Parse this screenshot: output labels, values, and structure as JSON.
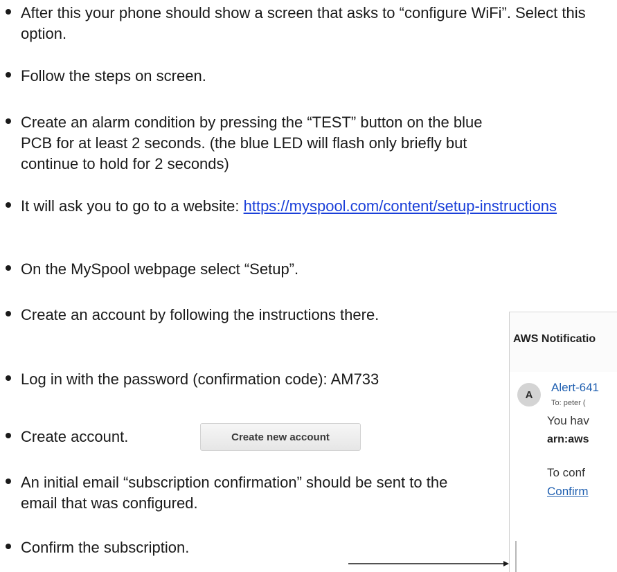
{
  "steps": [
    {
      "text": "After this your phone should show a screen that asks to “configure WiFi”.  Select this option."
    },
    {
      "text": "Follow the steps on screen."
    },
    {
      "text": "Create an alarm condition by pressing the “TEST” button on the blue PCB for at least 2 seconds. (the blue LED will flash only briefly but continue to hold for 2 seconds)"
    },
    {
      "prefix": "It will ask you to go to a website: ",
      "link": "https://myspool.com/content/setup-instructions"
    },
    {
      "text": "On the MySpool webpage select “Setup”."
    },
    {
      "text": "Create an account by following the instructions there."
    },
    {
      "text": "Log in with the password (confirmation code): AM733"
    },
    {
      "text": "Create account."
    },
    {
      "text": "An initial email “subscription confirmation” should be sent to the email that was configured."
    },
    {
      "text": "Confirm the subscription."
    }
  ],
  "create_button": {
    "label": "Create new account"
  },
  "email_preview": {
    "subject": "AWS Notificatio",
    "avatar_letter": "A",
    "sender": "Alert-641",
    "recipient": "To:  peter (",
    "body_line1": "You hav",
    "body_line2": "arn:aws",
    "body_line3": "To conf",
    "confirm_link": "Confirm"
  },
  "colors": {
    "text": "#1a1a1a",
    "link": "#1a3fd9",
    "email_link": "#1f5fb0"
  },
  "icons": {
    "arrow": "right-arrow-icon"
  }
}
